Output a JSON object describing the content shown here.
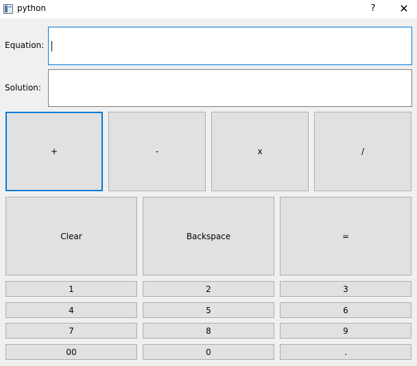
{
  "window": {
    "title": "python",
    "help_label": "?",
    "close_label": "✕"
  },
  "fields": {
    "equation_label": "Equation:",
    "equation_value": "",
    "solution_label": "Solution:",
    "solution_value": ""
  },
  "operators": [
    "+",
    "-",
    "x",
    "/"
  ],
  "actions": {
    "clear": "Clear",
    "backspace": "Backspace",
    "equals": "="
  },
  "keypad": [
    "1",
    "2",
    "3",
    "4",
    "5",
    "6",
    "7",
    "8",
    "9",
    "00",
    "0",
    "."
  ],
  "colors": {
    "focus_accent": "#0078d7",
    "button_face": "#e1e1e1",
    "window_bg": "#f0f0f0"
  }
}
